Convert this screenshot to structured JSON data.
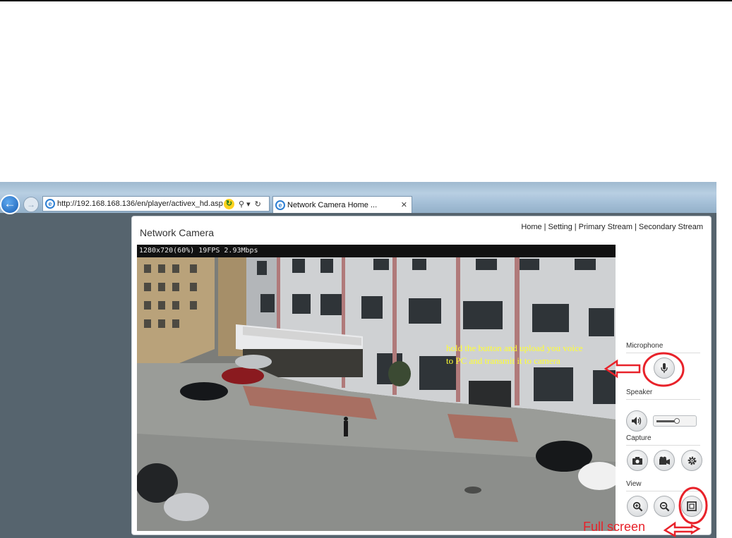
{
  "browser": {
    "address_url": "http://192.168.168.136/en/player/activex_hd.asp",
    "tab_title": "Network Camera Home ...",
    "back_glyph": "←",
    "forward_glyph": "→",
    "compat_glyph": "↻",
    "search_glyph": "⚲ ▾",
    "refresh_glyph": "↻",
    "tab_close_glyph": "✕",
    "icons": [
      "back-arrow-icon",
      "forward-arrow-icon",
      "ie-logo-icon",
      "compatibility-view-icon",
      "search-icon",
      "refresh-icon",
      "close-icon"
    ]
  },
  "page": {
    "title": "Network Camera",
    "links": [
      "Home",
      "Setting",
      "Primary Stream",
      "Secondary Stream"
    ],
    "link_separator": "|"
  },
  "video": {
    "info": "1280x720(60%) 19FPS 2.93Mbps",
    "annotation": "hold the button and upload you voice to PC and transmit it to camera"
  },
  "controls": {
    "microphone_label": "Microphone",
    "speaker_label": "Speaker",
    "capture_label": "Capture",
    "view_label": "View",
    "volume_level": 0.55,
    "capture_icons": [
      "camera-snapshot-icon",
      "video-record-icon",
      "settings-gear-icon"
    ],
    "view_icons": [
      "zoom-in-icon",
      "zoom-out-icon",
      "fullscreen-icon"
    ]
  },
  "annotations": {
    "fullscreen_caption": "Full screen",
    "highlight_color": "#e8222a"
  }
}
